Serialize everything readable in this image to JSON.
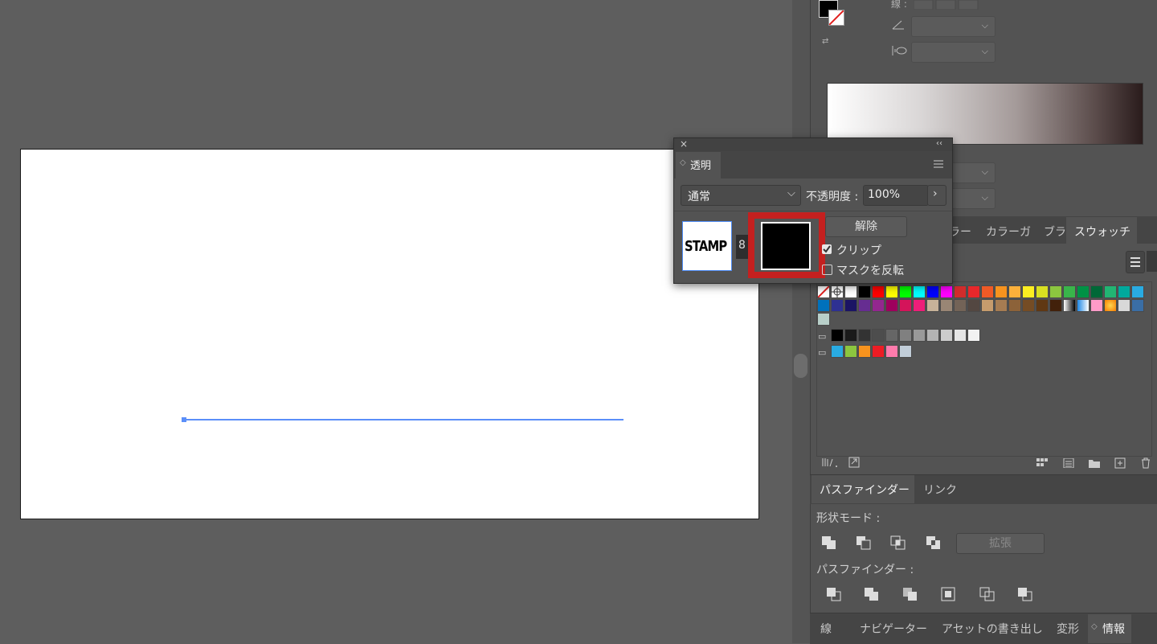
{
  "stroke_panel": {
    "label": "線 :"
  },
  "transparency": {
    "tab_label": "透明",
    "blend_mode": "通常",
    "opacity_label": "不透明度 :",
    "opacity_value": "100%",
    "thumbnail_text": "STAMP",
    "release_button": "解除",
    "clip_label": "クリップ",
    "invert_mask_label": "マスクを反転",
    "clip_checked": true,
    "invert_checked": false
  },
  "color_tabs": {
    "tab1": "ラー",
    "tab2": "カラーガ",
    "tab3": "ブラシ",
    "tab4": "スウォッチ"
  },
  "pathfinder": {
    "tab_pathfinder": "パスファインダー",
    "tab_links": "リンク",
    "shape_modes_label": "形状モード :",
    "expand_button": "拡張",
    "pathfinders_label": "パスファインダー :"
  },
  "bottom_tabs": {
    "stroke": "線",
    "navigator": "ナビゲーター",
    "asset_export": "アセットの書き出し",
    "transform": "変形",
    "info": "情報"
  },
  "swatches": {
    "row1": [
      "#ffffff",
      "#000000",
      "#ff0000",
      "#ffff00",
      "#00ff00",
      "#00ffff",
      "#0000ff",
      "#ff00ff",
      "#d12c2c",
      "#e8272b",
      "#ef5a26",
      "#f7931e",
      "#fbb03b",
      "#fcee21",
      "#d9e021",
      "#8cc63f",
      "#39b54a",
      "#009245",
      "#006837",
      "#22b573",
      "#00a99d",
      "#29abe2"
    ],
    "row2": [
      "#0071bc",
      "#2e3192",
      "#1b1464",
      "#662d91",
      "#93278f",
      "#9e005d",
      "#d4145a",
      "#ed1e79",
      "#c7b299",
      "#998675",
      "#736357",
      "#534741",
      "#c69c6d",
      "#a67c52",
      "#8c6239",
      "#754c24",
      "#603813",
      "#42210b"
    ],
    "row3": [
      "#000000",
      "#1a1a1a",
      "#333333",
      "#4d4d4d",
      "#666666",
      "#808080",
      "#999999",
      "#b3b3b3",
      "#cccccc",
      "#e6e6e6",
      "#f2f2f2"
    ],
    "row4": [
      "#29abe2",
      "#8cc63f",
      "#f7931e",
      "#ed1c24",
      "#ff7bac",
      "#c1cdd8"
    ]
  },
  "colors": {
    "highlight": "#c4201f",
    "selection": "#5b8ff9"
  }
}
